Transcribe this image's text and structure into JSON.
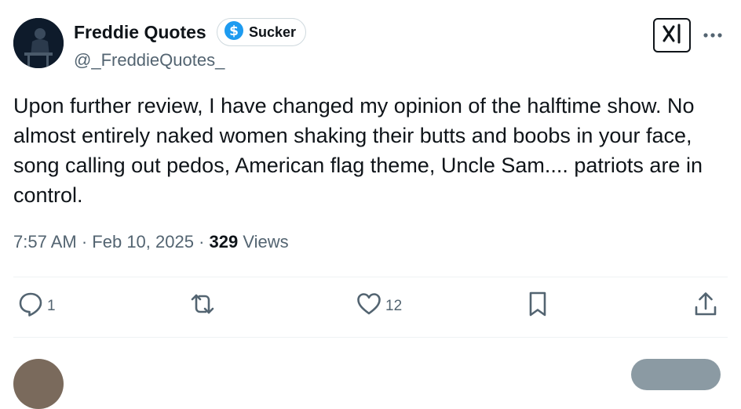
{
  "tweet": {
    "author_name": "Freddie Quotes",
    "badge_label": "Sucker",
    "handle": "@_FreddieQuotes_",
    "text": "Upon further review, I have changed my opinion of the halftime show.  No almost entirely naked women shaking their butts and boobs in your face, song calling out pedos, American flag theme,  Uncle Sam.... patriots are in control.",
    "time": "7:57 AM",
    "separator": "·",
    "date": "Feb 10, 2025",
    "views_count": "329",
    "views_label": "Views"
  },
  "actions": {
    "reply_count": "1",
    "like_count": "12"
  },
  "icons": {
    "avatar": "profile-photo",
    "badge": "dollar-sign-icon",
    "grok": "grok-icon",
    "more": "more-dots-icon",
    "reply": "reply-icon",
    "retweet": "retweet-icon",
    "like": "heart-icon",
    "bookmark": "bookmark-icon",
    "share": "share-icon"
  },
  "colors": {
    "text_primary": "#0f1419",
    "text_secondary": "#536471",
    "badge_icon": "#1d9bf0",
    "divider": "#eff3f4"
  }
}
